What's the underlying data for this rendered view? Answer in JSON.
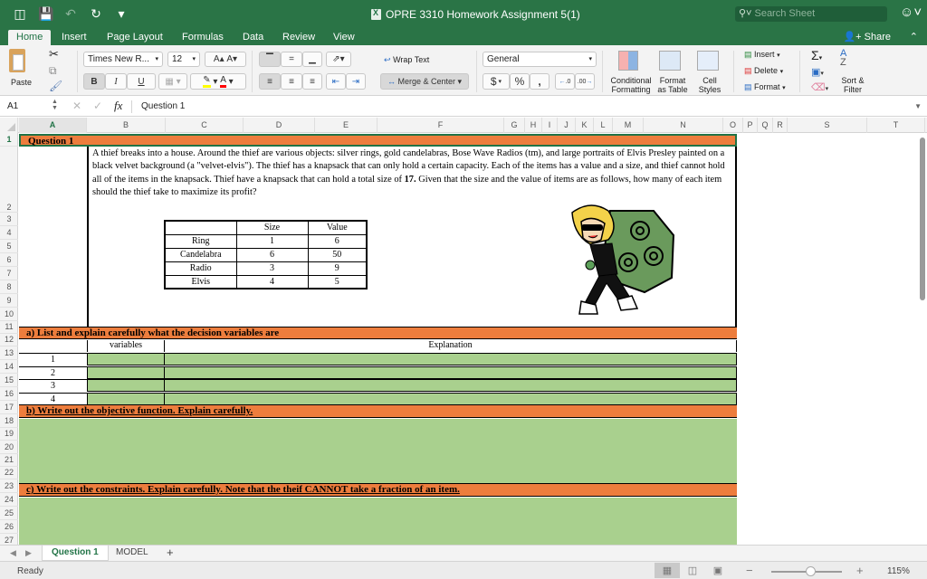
{
  "window": {
    "title": "OPRE 3310 Homework Assignment 5(1)",
    "search_placeholder": "Search Sheet"
  },
  "ribbon_tabs": [
    "Home",
    "Insert",
    "Page Layout",
    "Formulas",
    "Data",
    "Review",
    "View"
  ],
  "active_ribbon_tab": "Home",
  "share_label": "Share",
  "ribbon": {
    "paste_label": "Paste",
    "font_name": "Times New R...",
    "font_size": "12",
    "bold": "B",
    "italic": "I",
    "underline": "U",
    "wrap_text": "Wrap Text",
    "merge_center": "Merge & Center",
    "number_format": "General",
    "currency": "$",
    "percent": "%",
    "comma": ",",
    "increase_decimal": "←.0 .00",
    "decrease_decimal": ".00 →.0",
    "conditional_formatting": [
      "Conditional",
      "Formatting"
    ],
    "format_as_table": [
      "Format",
      "as Table"
    ],
    "cell_styles": [
      "Cell",
      "Styles"
    ],
    "insert": "Insert",
    "delete": "Delete",
    "format": "Format",
    "sort_filter": [
      "Sort &",
      "Filter"
    ],
    "colors": {
      "highlight": "#ffff00",
      "font_color": "#ff0000"
    }
  },
  "formula_bar": {
    "name_box": "A1",
    "content": "Question 1"
  },
  "columns": [
    "A",
    "B",
    "C",
    "D",
    "E",
    "F",
    "G",
    "H",
    "I",
    "J",
    "K",
    "L",
    "M",
    "N",
    "O",
    "P",
    "Q",
    "R",
    "S",
    "T"
  ],
  "selected_cell": "A1",
  "rows": [
    "1",
    "2",
    "3",
    "4",
    "5",
    "6",
    "7",
    "8",
    "9",
    "10",
    "11",
    "12",
    "13",
    "14",
    "15",
    "16",
    "17",
    "18",
    "19",
    "20",
    "21",
    "22",
    "23",
    "24",
    "25",
    "26",
    "27"
  ],
  "sheet": {
    "title": "Question 1",
    "problem_text_1": "A thief breaks into a house. Around the thief are various objects: silver rings, gold candelabras, Bose Wave Radios (tm), and large portraits of Elvis Presley painted on a black velvet background (a \"velvet-elvis\"). The thief has a knapsack that can only hold a certain capacity. Each of the items has a value and a size, and thief cannot hold all of the items in the knapsack. Thief have a knapsack that can hold a total size of ",
    "problem_capacity": "17.",
    "problem_text_2": " Given that the size and the value of items are as follows, how many of each item should the thief take to maximize its profit?",
    "items_table": {
      "headers": [
        "",
        "Size",
        "Value"
      ],
      "rows": [
        [
          "Ring",
          "1",
          "6"
        ],
        [
          "Candelabra",
          "6",
          "50"
        ],
        [
          "Radio",
          "3",
          "9"
        ],
        [
          "Elvis",
          "4",
          "5"
        ]
      ]
    },
    "image_alt": "cartoon thief with knapsack",
    "section_a": "a) List and explain carefully what the decision variables are",
    "section_a_headers": {
      "variables": "variables",
      "explanation": "Explanation"
    },
    "section_a_rows": [
      "1",
      "2",
      "3",
      "4"
    ],
    "section_b": "b) Write out the objective function. Explain carefully.",
    "section_c": "c) Write out the constraints. Explain carefully. Note that the theif CANNOT take a fraction of an item.",
    "colors": {
      "header_orange": "#ed7d3d",
      "answer_green": "#a9d08e"
    }
  },
  "sheet_tabs": [
    "Question 1",
    "MODEL"
  ],
  "active_sheet_tab": "Question 1",
  "add_sheet": "+",
  "status": {
    "text": "Ready",
    "zoom": "115%"
  }
}
